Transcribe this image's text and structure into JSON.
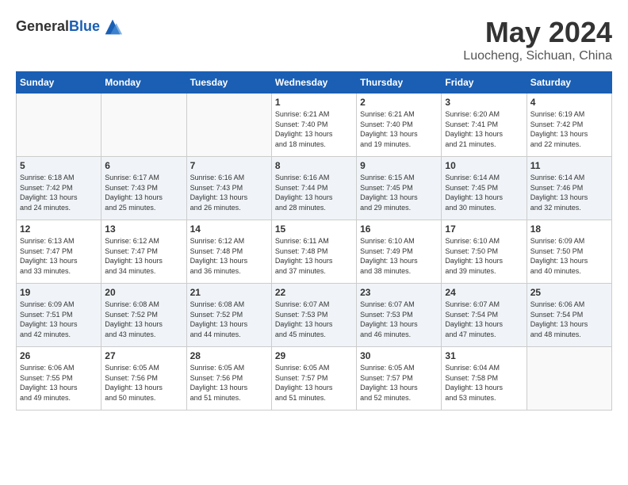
{
  "header": {
    "logo_general": "General",
    "logo_blue": "Blue",
    "month_title": "May 2024",
    "location": "Luocheng, Sichuan, China"
  },
  "days_of_week": [
    "Sunday",
    "Monday",
    "Tuesday",
    "Wednesday",
    "Thursday",
    "Friday",
    "Saturday"
  ],
  "weeks": [
    [
      {
        "day": "",
        "info": ""
      },
      {
        "day": "",
        "info": ""
      },
      {
        "day": "",
        "info": ""
      },
      {
        "day": "1",
        "info": "Sunrise: 6:21 AM\nSunset: 7:40 PM\nDaylight: 13 hours\nand 18 minutes."
      },
      {
        "day": "2",
        "info": "Sunrise: 6:21 AM\nSunset: 7:40 PM\nDaylight: 13 hours\nand 19 minutes."
      },
      {
        "day": "3",
        "info": "Sunrise: 6:20 AM\nSunset: 7:41 PM\nDaylight: 13 hours\nand 21 minutes."
      },
      {
        "day": "4",
        "info": "Sunrise: 6:19 AM\nSunset: 7:42 PM\nDaylight: 13 hours\nand 22 minutes."
      }
    ],
    [
      {
        "day": "5",
        "info": "Sunrise: 6:18 AM\nSunset: 7:42 PM\nDaylight: 13 hours\nand 24 minutes."
      },
      {
        "day": "6",
        "info": "Sunrise: 6:17 AM\nSunset: 7:43 PM\nDaylight: 13 hours\nand 25 minutes."
      },
      {
        "day": "7",
        "info": "Sunrise: 6:16 AM\nSunset: 7:43 PM\nDaylight: 13 hours\nand 26 minutes."
      },
      {
        "day": "8",
        "info": "Sunrise: 6:16 AM\nSunset: 7:44 PM\nDaylight: 13 hours\nand 28 minutes."
      },
      {
        "day": "9",
        "info": "Sunrise: 6:15 AM\nSunset: 7:45 PM\nDaylight: 13 hours\nand 29 minutes."
      },
      {
        "day": "10",
        "info": "Sunrise: 6:14 AM\nSunset: 7:45 PM\nDaylight: 13 hours\nand 30 minutes."
      },
      {
        "day": "11",
        "info": "Sunrise: 6:14 AM\nSunset: 7:46 PM\nDaylight: 13 hours\nand 32 minutes."
      }
    ],
    [
      {
        "day": "12",
        "info": "Sunrise: 6:13 AM\nSunset: 7:47 PM\nDaylight: 13 hours\nand 33 minutes."
      },
      {
        "day": "13",
        "info": "Sunrise: 6:12 AM\nSunset: 7:47 PM\nDaylight: 13 hours\nand 34 minutes."
      },
      {
        "day": "14",
        "info": "Sunrise: 6:12 AM\nSunset: 7:48 PM\nDaylight: 13 hours\nand 36 minutes."
      },
      {
        "day": "15",
        "info": "Sunrise: 6:11 AM\nSunset: 7:48 PM\nDaylight: 13 hours\nand 37 minutes."
      },
      {
        "day": "16",
        "info": "Sunrise: 6:10 AM\nSunset: 7:49 PM\nDaylight: 13 hours\nand 38 minutes."
      },
      {
        "day": "17",
        "info": "Sunrise: 6:10 AM\nSunset: 7:50 PM\nDaylight: 13 hours\nand 39 minutes."
      },
      {
        "day": "18",
        "info": "Sunrise: 6:09 AM\nSunset: 7:50 PM\nDaylight: 13 hours\nand 40 minutes."
      }
    ],
    [
      {
        "day": "19",
        "info": "Sunrise: 6:09 AM\nSunset: 7:51 PM\nDaylight: 13 hours\nand 42 minutes."
      },
      {
        "day": "20",
        "info": "Sunrise: 6:08 AM\nSunset: 7:52 PM\nDaylight: 13 hours\nand 43 minutes."
      },
      {
        "day": "21",
        "info": "Sunrise: 6:08 AM\nSunset: 7:52 PM\nDaylight: 13 hours\nand 44 minutes."
      },
      {
        "day": "22",
        "info": "Sunrise: 6:07 AM\nSunset: 7:53 PM\nDaylight: 13 hours\nand 45 minutes."
      },
      {
        "day": "23",
        "info": "Sunrise: 6:07 AM\nSunset: 7:53 PM\nDaylight: 13 hours\nand 46 minutes."
      },
      {
        "day": "24",
        "info": "Sunrise: 6:07 AM\nSunset: 7:54 PM\nDaylight: 13 hours\nand 47 minutes."
      },
      {
        "day": "25",
        "info": "Sunrise: 6:06 AM\nSunset: 7:54 PM\nDaylight: 13 hours\nand 48 minutes."
      }
    ],
    [
      {
        "day": "26",
        "info": "Sunrise: 6:06 AM\nSunset: 7:55 PM\nDaylight: 13 hours\nand 49 minutes."
      },
      {
        "day": "27",
        "info": "Sunrise: 6:05 AM\nSunset: 7:56 PM\nDaylight: 13 hours\nand 50 minutes."
      },
      {
        "day": "28",
        "info": "Sunrise: 6:05 AM\nSunset: 7:56 PM\nDaylight: 13 hours\nand 51 minutes."
      },
      {
        "day": "29",
        "info": "Sunrise: 6:05 AM\nSunset: 7:57 PM\nDaylight: 13 hours\nand 51 minutes."
      },
      {
        "day": "30",
        "info": "Sunrise: 6:05 AM\nSunset: 7:57 PM\nDaylight: 13 hours\nand 52 minutes."
      },
      {
        "day": "31",
        "info": "Sunrise: 6:04 AM\nSunset: 7:58 PM\nDaylight: 13 hours\nand 53 minutes."
      },
      {
        "day": "",
        "info": ""
      }
    ]
  ]
}
